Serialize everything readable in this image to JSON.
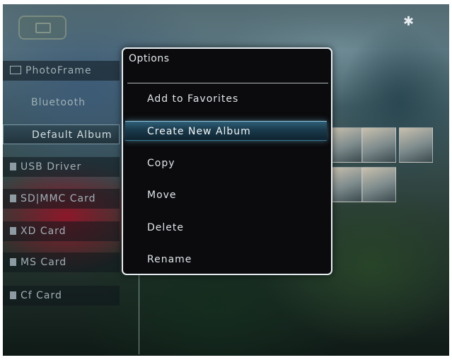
{
  "topbar": {
    "logo_icon": "photo-frame-icon",
    "bluetooth_icon": "bluetooth-icon",
    "bluetooth_glyph": "✱"
  },
  "left_menu": {
    "items": [
      {
        "label": "PhotoFrame",
        "icon": "photo-frame-icon"
      },
      {
        "label": "Bluetooth"
      },
      {
        "label": "Default Album"
      },
      {
        "label": "USB Driver",
        "icon": "usb-icon"
      },
      {
        "label": "SD|MMC Card",
        "icon": "card-icon"
      },
      {
        "label": "XD Card",
        "icon": "card-icon"
      },
      {
        "label": "MS Card",
        "icon": "card-icon"
      },
      {
        "label": "Cf Card",
        "icon": "card-icon"
      }
    ],
    "selected": "Default Album"
  },
  "options_dialog": {
    "title": "Options",
    "items": [
      {
        "label": "Add to Favorites"
      },
      {
        "label": "Create New Album"
      },
      {
        "label": "Copy"
      },
      {
        "label": "Move"
      },
      {
        "label": "Delete"
      },
      {
        "label": "Rename"
      }
    ],
    "selected": "Create New Album"
  },
  "colors": {
    "dialog_bg": "#0b0b0d",
    "dialog_border": "#e7eef2",
    "highlight": "#2e5f78"
  }
}
